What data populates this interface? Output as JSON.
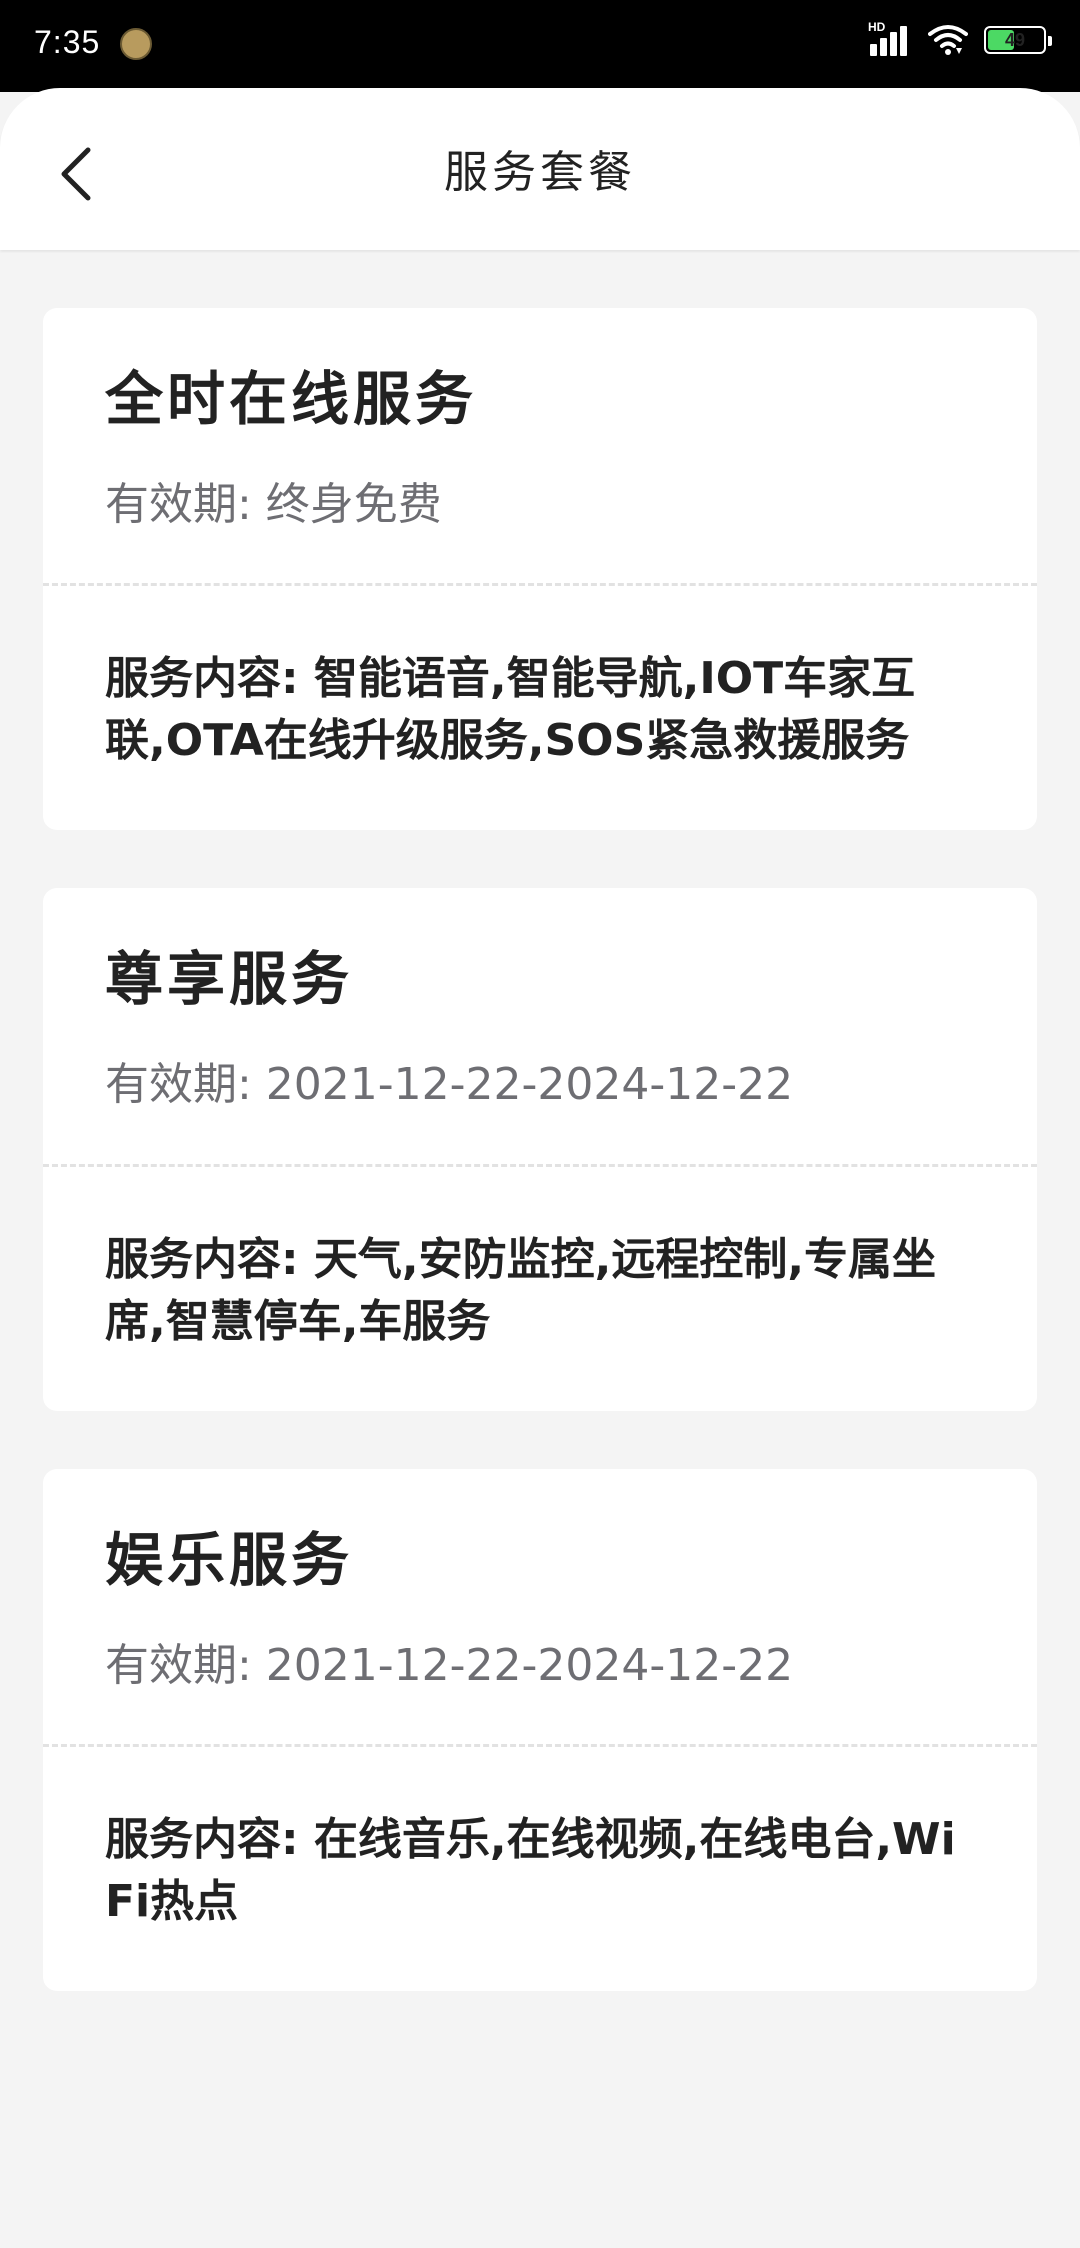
{
  "status_bar": {
    "time": "7:35",
    "network": "HD",
    "battery": "49",
    "battery_level": 0.49
  },
  "header": {
    "title": "服务套餐"
  },
  "services": [
    {
      "title": "全时在线服务",
      "validity": "有效期: 终身免费",
      "content": "服务内容: 智能语音,智能导航,IOT车家互联,OTA在线升级服务,SOS紧急救援服务"
    },
    {
      "title": "尊享服务",
      "validity": "有效期: 2021-12-22-2024-12-22",
      "content": "服务内容: 天气,安防监控,远程控制,专属坐席,智慧停车,车服务"
    },
    {
      "title": "娱乐服务",
      "validity": "有效期: 2021-12-22-2024-12-22",
      "content": "服务内容: 在线音乐,在线视频,在线电台,WiFi热点"
    }
  ]
}
